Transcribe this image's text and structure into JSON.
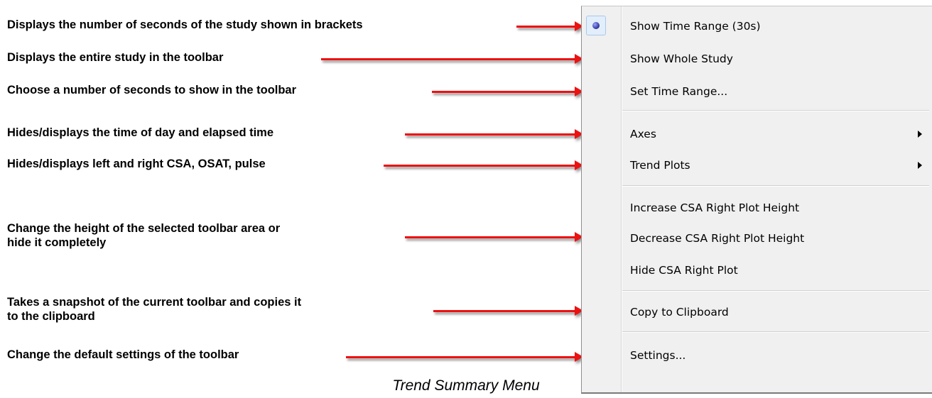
{
  "annotations": [
    "Displays the number of seconds of the study shown in brackets",
    "Displays the entire study in the toolbar",
    "Choose a number of seconds to show in the toolbar",
    "Hides/displays the time of day and elapsed time",
    "Hides/displays left and right CSA, OSAT, pulse",
    "Change the height of the selected toolbar area or",
    "hide it completely",
    "Takes a snapshot of the current toolbar and copies it",
    "to the clipboard",
    "Change the default settings of the toolbar"
  ],
  "menu": {
    "items": [
      {
        "label": "Show Time Range (30s)",
        "selected": true
      },
      {
        "label": "Show Whole Study"
      },
      {
        "label": "Set Time Range..."
      },
      {
        "label": "Axes",
        "submenu": true
      },
      {
        "label": "Trend Plots",
        "submenu": true
      },
      {
        "label": "Increase CSA Right Plot Height"
      },
      {
        "label": "Decrease CSA Right Plot Height"
      },
      {
        "label": "Hide CSA Right Plot"
      },
      {
        "label": "Copy to Clipboard"
      },
      {
        "label": "Settings..."
      }
    ]
  },
  "caption": "Trend Summary Menu",
  "colors": {
    "arrow": "#ee1111",
    "menu_bg": "#f0f0f0",
    "radio": "#2b2f9a"
  }
}
